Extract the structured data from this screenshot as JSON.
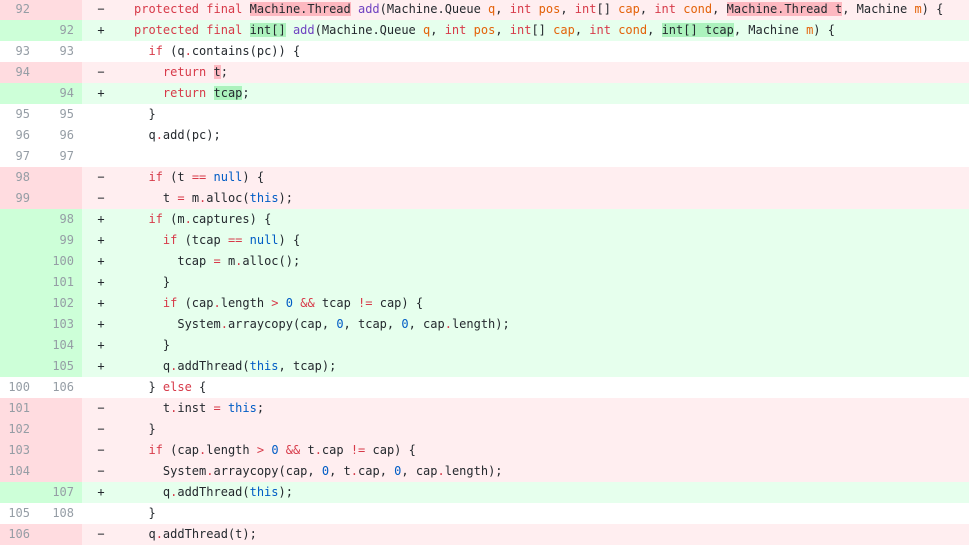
{
  "diff": {
    "lines": [
      {
        "type": "del",
        "old": "92",
        "new": "",
        "sign": "−",
        "tokens": [
          [
            "protected final ",
            "kw"
          ],
          [
            "Machine.Thread",
            "hl-del"
          ],
          [
            " "
          ],
          [
            "add",
            "fn"
          ],
          [
            "(Machine.Queue "
          ],
          [
            "q",
            "var"
          ],
          [
            ", "
          ],
          [
            "int",
            "kw"
          ],
          [
            " "
          ],
          [
            "pos",
            "var"
          ],
          [
            ", "
          ],
          [
            "int",
            "kw"
          ],
          [
            "[] "
          ],
          [
            "cap",
            "var"
          ],
          [
            ", "
          ],
          [
            "int",
            "kw"
          ],
          [
            " "
          ],
          [
            "cond",
            "var"
          ],
          [
            ", "
          ],
          [
            "Machine.Thread t",
            "hl-del"
          ],
          [
            ", Machine "
          ],
          [
            "m",
            "var"
          ],
          [
            ") {"
          ]
        ]
      },
      {
        "type": "add",
        "old": "",
        "new": "92",
        "sign": "+",
        "tokens": [
          [
            "protected final ",
            "kw"
          ],
          [
            "int[]",
            "hl-add"
          ],
          [
            " "
          ],
          [
            "add",
            "fn"
          ],
          [
            "(Machine.Queue "
          ],
          [
            "q",
            "var"
          ],
          [
            ", "
          ],
          [
            "int",
            "kw"
          ],
          [
            " "
          ],
          [
            "pos",
            "var"
          ],
          [
            ", "
          ],
          [
            "int",
            "kw"
          ],
          [
            "[] "
          ],
          [
            "cap",
            "var"
          ],
          [
            ", "
          ],
          [
            "int",
            "kw"
          ],
          [
            " "
          ],
          [
            "cond",
            "var"
          ],
          [
            ", "
          ],
          [
            "int[] tcap",
            "hl-add"
          ],
          [
            ", Machine "
          ],
          [
            "m",
            "var"
          ],
          [
            ") {"
          ]
        ]
      },
      {
        "type": "ctx",
        "old": "93",
        "new": "93",
        "sign": "",
        "tokens": [
          [
            "  "
          ],
          [
            "if",
            "kw"
          ],
          [
            " (q"
          ],
          [
            ".",
            "kw"
          ],
          [
            "contains(pc)) {"
          ]
        ]
      },
      {
        "type": "del",
        "old": "94",
        "new": "",
        "sign": "−",
        "tokens": [
          [
            "    "
          ],
          [
            "return",
            "kw"
          ],
          [
            " "
          ],
          [
            "t",
            "hl-del"
          ],
          [
            ";"
          ]
        ]
      },
      {
        "type": "add",
        "old": "",
        "new": "94",
        "sign": "+",
        "tokens": [
          [
            "    "
          ],
          [
            "return",
            "kw"
          ],
          [
            " "
          ],
          [
            "tcap",
            "hl-add"
          ],
          [
            ";"
          ]
        ]
      },
      {
        "type": "ctx",
        "old": "95",
        "new": "95",
        "sign": "",
        "tokens": [
          [
            "  }"
          ]
        ]
      },
      {
        "type": "ctx",
        "old": "96",
        "new": "96",
        "sign": "",
        "tokens": [
          [
            "  q"
          ],
          [
            ".",
            "kw"
          ],
          [
            "add(pc);"
          ]
        ]
      },
      {
        "type": "ctx",
        "old": "97",
        "new": "97",
        "sign": "",
        "tokens": [
          [
            ""
          ]
        ]
      },
      {
        "type": "del",
        "old": "98",
        "new": "",
        "sign": "−",
        "tokens": [
          [
            "  "
          ],
          [
            "if",
            "kw"
          ],
          [
            " (t "
          ],
          [
            "==",
            "kw"
          ],
          [
            " "
          ],
          [
            "null",
            "lit"
          ],
          [
            ") {"
          ]
        ]
      },
      {
        "type": "del",
        "old": "99",
        "new": "",
        "sign": "−",
        "tokens": [
          [
            "    t "
          ],
          [
            "=",
            "kw"
          ],
          [
            " m"
          ],
          [
            ".",
            "kw"
          ],
          [
            "alloc("
          ],
          [
            "this",
            "lit"
          ],
          [
            ");"
          ]
        ]
      },
      {
        "type": "add",
        "old": "",
        "new": "98",
        "sign": "+",
        "tokens": [
          [
            "  "
          ],
          [
            "if",
            "kw"
          ],
          [
            " (m"
          ],
          [
            ".",
            "kw"
          ],
          [
            "captures) {"
          ]
        ]
      },
      {
        "type": "add",
        "old": "",
        "new": "99",
        "sign": "+",
        "tokens": [
          [
            "    "
          ],
          [
            "if",
            "kw"
          ],
          [
            " (tcap "
          ],
          [
            "==",
            "kw"
          ],
          [
            " "
          ],
          [
            "null",
            "lit"
          ],
          [
            ") {"
          ]
        ]
      },
      {
        "type": "add",
        "old": "",
        "new": "100",
        "sign": "+",
        "tokens": [
          [
            "      tcap "
          ],
          [
            "=",
            "kw"
          ],
          [
            " m"
          ],
          [
            ".",
            "kw"
          ],
          [
            "alloc();"
          ]
        ]
      },
      {
        "type": "add",
        "old": "",
        "new": "101",
        "sign": "+",
        "tokens": [
          [
            "    }"
          ]
        ]
      },
      {
        "type": "add",
        "old": "",
        "new": "102",
        "sign": "+",
        "tokens": [
          [
            "    "
          ],
          [
            "if",
            "kw"
          ],
          [
            " (cap"
          ],
          [
            ".",
            "kw"
          ],
          [
            "length "
          ],
          [
            ">",
            "kw"
          ],
          [
            " "
          ],
          [
            "0",
            "lit"
          ],
          [
            " "
          ],
          [
            "&&",
            "kw"
          ],
          [
            " tcap "
          ],
          [
            "!=",
            "kw"
          ],
          [
            " cap) {"
          ]
        ]
      },
      {
        "type": "add",
        "old": "",
        "new": "103",
        "sign": "+",
        "tokens": [
          [
            "      System"
          ],
          [
            ".",
            "kw"
          ],
          [
            "arraycopy(cap, "
          ],
          [
            "0",
            "lit"
          ],
          [
            ", tcap, "
          ],
          [
            "0",
            "lit"
          ],
          [
            ", cap"
          ],
          [
            ".",
            "kw"
          ],
          [
            "length);"
          ]
        ]
      },
      {
        "type": "add",
        "old": "",
        "new": "104",
        "sign": "+",
        "tokens": [
          [
            "    }"
          ]
        ]
      },
      {
        "type": "add",
        "old": "",
        "new": "105",
        "sign": "+",
        "tokens": [
          [
            "    q"
          ],
          [
            ".",
            "kw"
          ],
          [
            "addThread("
          ],
          [
            "this",
            "lit"
          ],
          [
            ", tcap);"
          ]
        ]
      },
      {
        "type": "ctx",
        "old": "100",
        "new": "106",
        "sign": "",
        "tokens": [
          [
            "  } "
          ],
          [
            "else",
            "kw"
          ],
          [
            " {"
          ]
        ]
      },
      {
        "type": "del",
        "old": "101",
        "new": "",
        "sign": "−",
        "tokens": [
          [
            "    t"
          ],
          [
            ".",
            "kw"
          ],
          [
            "inst "
          ],
          [
            "=",
            "kw"
          ],
          [
            " "
          ],
          [
            "this",
            "lit"
          ],
          [
            ";"
          ]
        ]
      },
      {
        "type": "del",
        "old": "102",
        "new": "",
        "sign": "−",
        "tokens": [
          [
            "  }"
          ]
        ]
      },
      {
        "type": "del",
        "old": "103",
        "new": "",
        "sign": "−",
        "tokens": [
          [
            "  "
          ],
          [
            "if",
            "kw"
          ],
          [
            " (cap"
          ],
          [
            ".",
            "kw"
          ],
          [
            "length "
          ],
          [
            ">",
            "kw"
          ],
          [
            " "
          ],
          [
            "0",
            "lit"
          ],
          [
            " "
          ],
          [
            "&&",
            "kw"
          ],
          [
            " t"
          ],
          [
            ".",
            "kw"
          ],
          [
            "cap "
          ],
          [
            "!=",
            "kw"
          ],
          [
            " cap) {"
          ]
        ]
      },
      {
        "type": "del",
        "old": "104",
        "new": "",
        "sign": "−",
        "tokens": [
          [
            "    System"
          ],
          [
            ".",
            "kw"
          ],
          [
            "arraycopy(cap, "
          ],
          [
            "0",
            "lit"
          ],
          [
            ", t"
          ],
          [
            ".",
            "kw"
          ],
          [
            "cap, "
          ],
          [
            "0",
            "lit"
          ],
          [
            ", cap"
          ],
          [
            ".",
            "kw"
          ],
          [
            "length);"
          ]
        ]
      },
      {
        "type": "add",
        "old": "",
        "new": "107",
        "sign": "+",
        "tokens": [
          [
            "    q"
          ],
          [
            ".",
            "kw"
          ],
          [
            "addThread("
          ],
          [
            "this",
            "lit"
          ],
          [
            ");"
          ]
        ]
      },
      {
        "type": "ctx",
        "old": "105",
        "new": "108",
        "sign": "",
        "tokens": [
          [
            "  }"
          ]
        ]
      },
      {
        "type": "del",
        "old": "106",
        "new": "",
        "sign": "−",
        "tokens": [
          [
            "  q"
          ],
          [
            ".",
            "kw"
          ],
          [
            "addThread(t);"
          ]
        ]
      }
    ]
  },
  "colors": {
    "del_bg": "#ffeef0",
    "del_gutter": "#ffdce0",
    "del_highlight": "#fdb8c0",
    "add_bg": "#e6ffed",
    "add_gutter": "#cdffd8",
    "add_highlight": "#acf2bd",
    "keyword": "#d73a49",
    "literal": "#005cc5",
    "function": "#6f42c1",
    "parameter": "#e36209"
  }
}
